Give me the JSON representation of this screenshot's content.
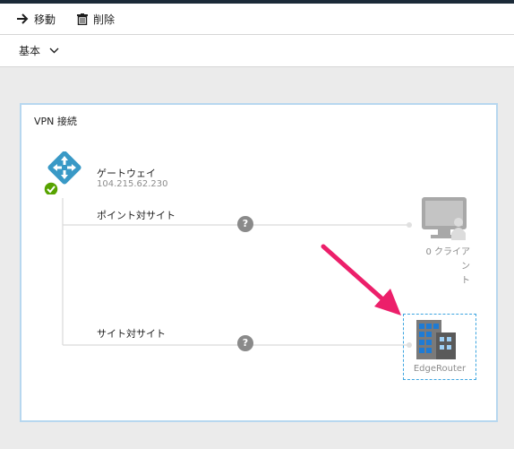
{
  "toolbar": {
    "move_label": "移動",
    "delete_label": "削除"
  },
  "essentials": {
    "label": "基本"
  },
  "tile": {
    "title": "VPN 接続",
    "gateway": {
      "name": "ゲートウェイ",
      "ip": "104.215.62.230",
      "icon": "gateway-icon",
      "status": "succeeded"
    },
    "point_to_site": {
      "label": "ポイント対サイト",
      "clients_line1": "0 クライアン",
      "clients_line2": "ト"
    },
    "site_to_site": {
      "label": "サイト対サイト",
      "site_name": "EdgeRouter"
    },
    "help_glyph": "?"
  },
  "colors": {
    "accent": "#1b2a38",
    "selection_border": "#3da5e0",
    "arrow": "#ec1f6a",
    "status_ok": "#57a300",
    "gateway_blue": "#3999c6"
  }
}
